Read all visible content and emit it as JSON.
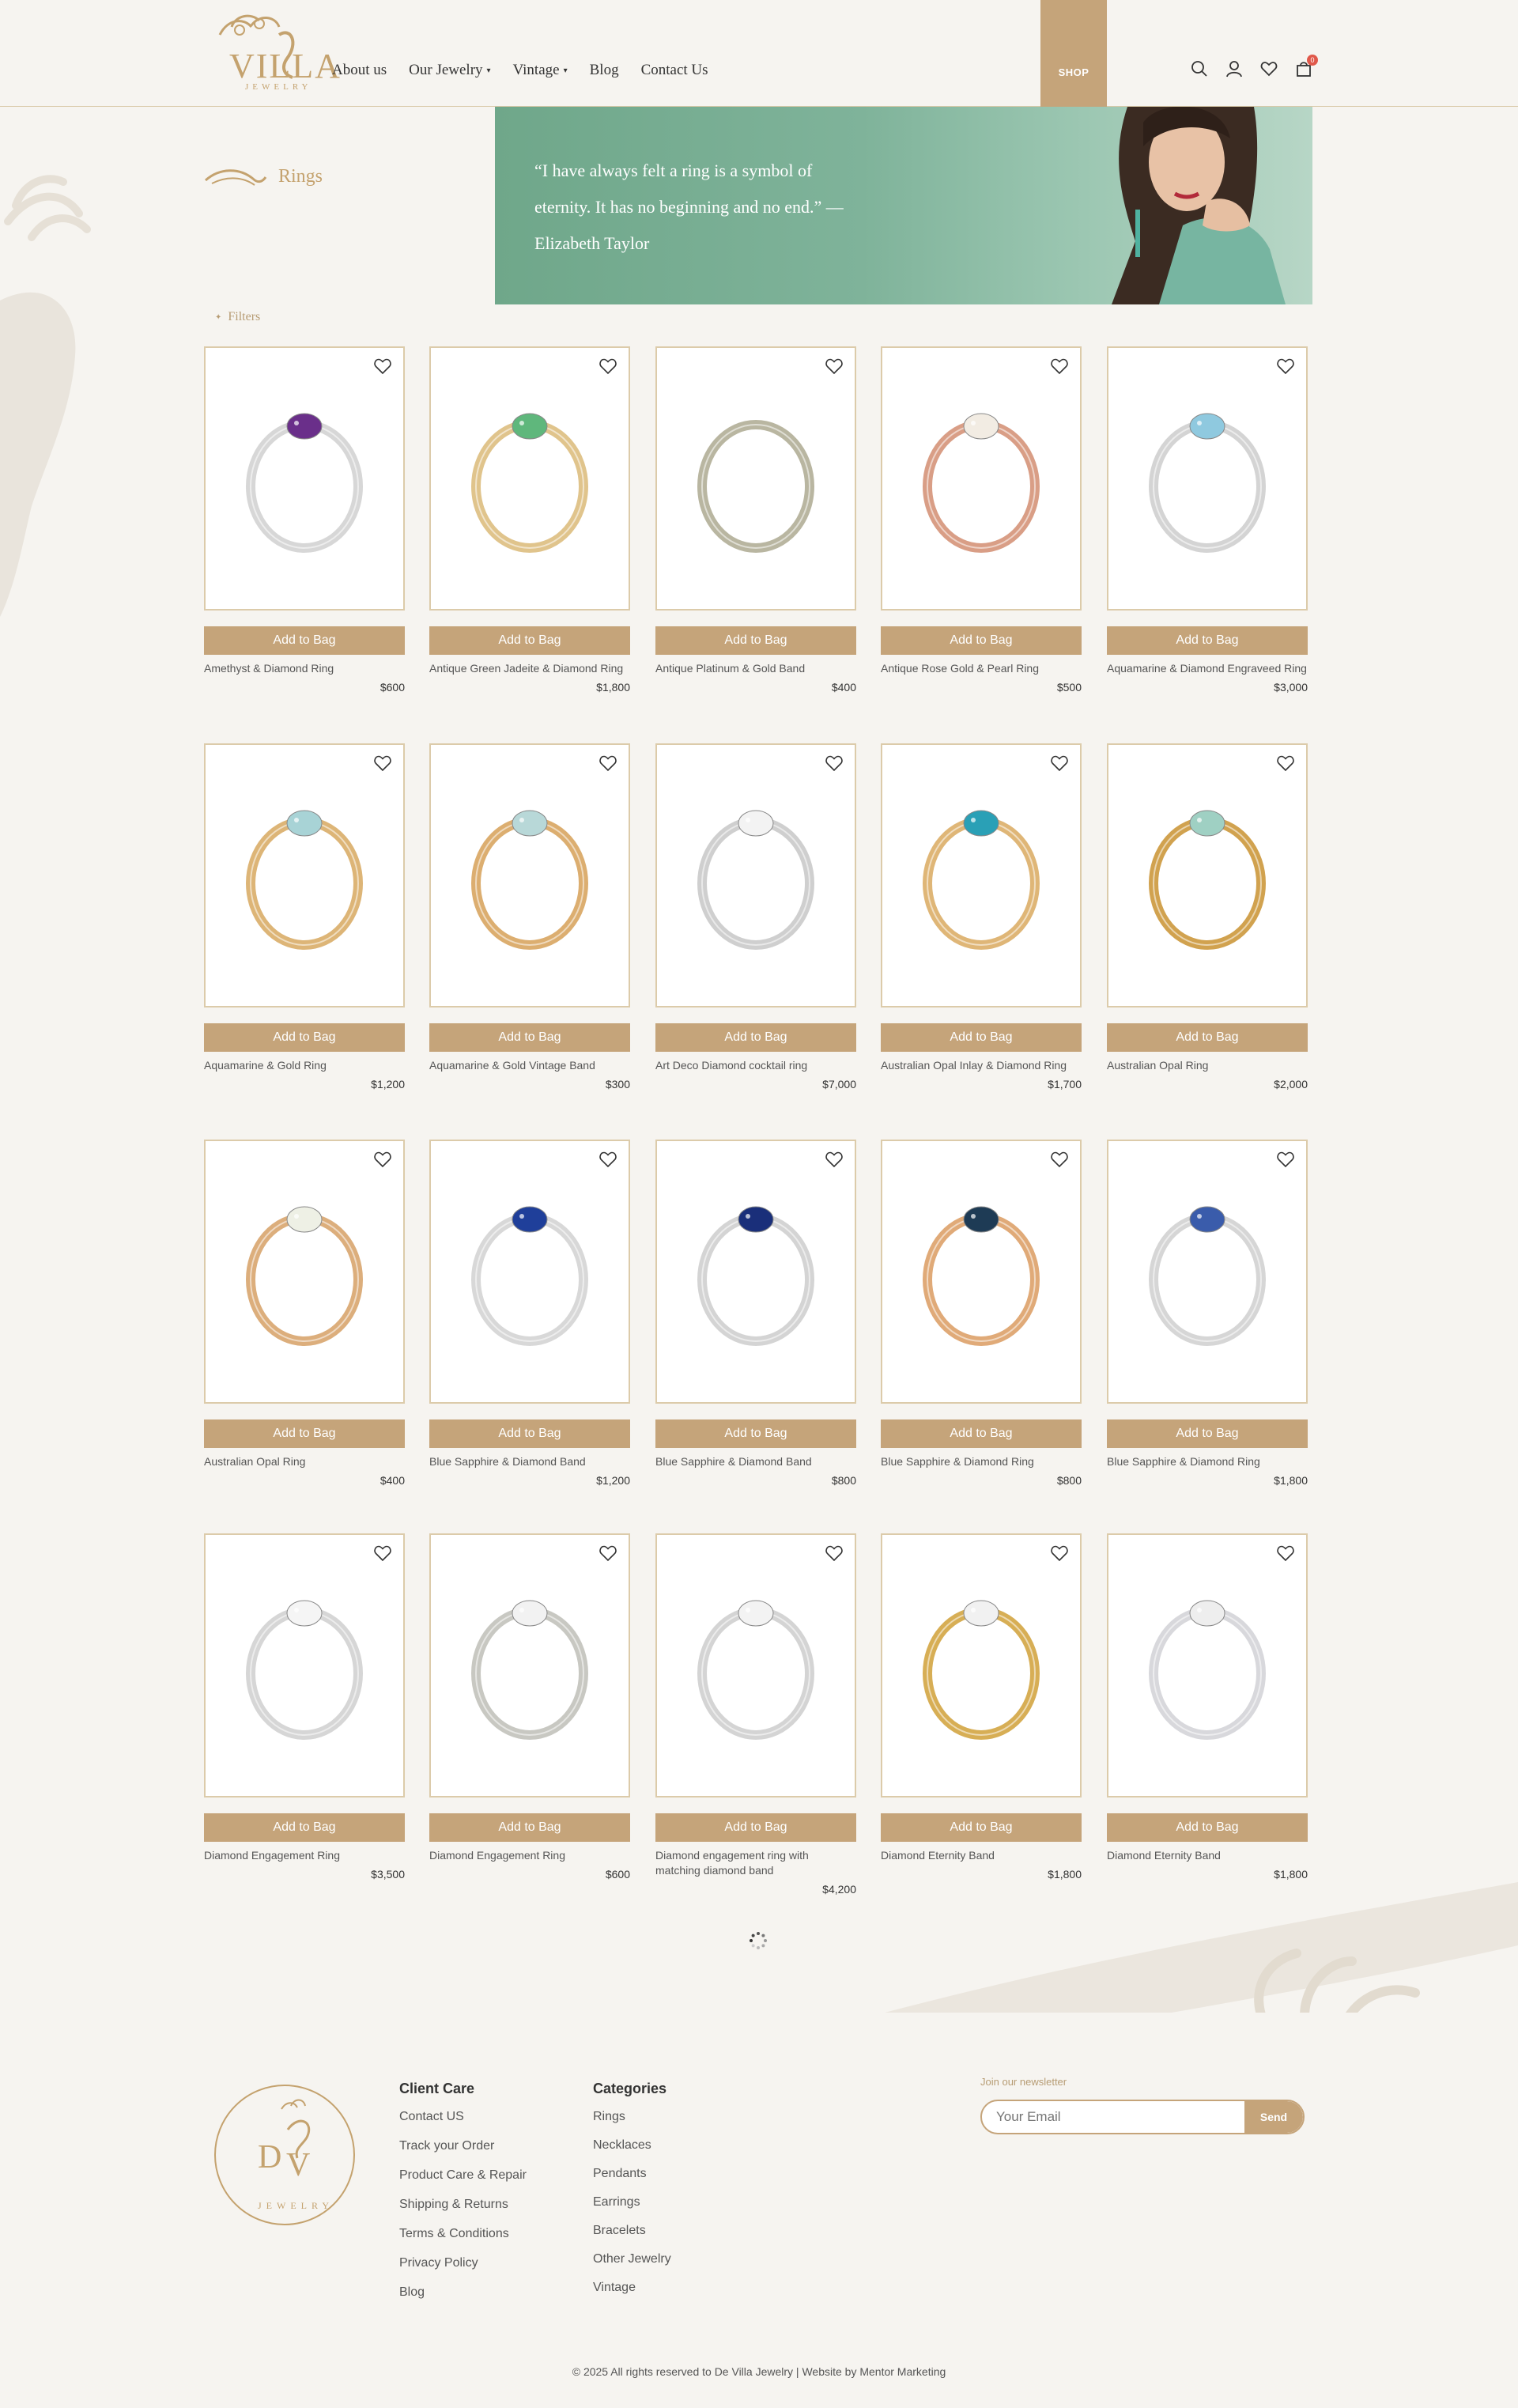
{
  "header": {
    "logo_text": "VILLA",
    "logo_sub": "JEWELRY",
    "nav": [
      {
        "label": "About us",
        "caret": false
      },
      {
        "label": "Our Jewelry",
        "caret": true
      },
      {
        "label": "Vintage",
        "caret": true
      },
      {
        "label": "Blog",
        "caret": false
      },
      {
        "label": "Contact Us",
        "caret": false
      }
    ],
    "shop_label": "SHOP",
    "cart_count": "0",
    "icons": [
      "search-icon",
      "user-icon",
      "heart-icon",
      "bag-icon"
    ]
  },
  "hero": {
    "title": "Rings",
    "quote": "“I have always felt a ring is a symbol of eternity. It has no beginning and no end.” — Elizabeth Taylor"
  },
  "filters_label": "Filters",
  "products": [
    {
      "name": "Amethyst & Diamond Ring",
      "price": "$600",
      "button": "Add to Bag",
      "metal": "#d7d7d7",
      "stone": "#6a2f8a"
    },
    {
      "name": "Antique Green Jadeite & Diamond Ring",
      "price": "$1,800",
      "button": "Add to Bag",
      "metal": "#e0c48c",
      "stone": "#5fb77c"
    },
    {
      "name": "Antique Platinum & Gold Band",
      "price": "$400",
      "button": "Add to Bag",
      "metal": "#b9b6a1",
      "stone": ""
    },
    {
      "name": "Antique Rose Gold & Pearl Ring",
      "price": "$500",
      "button": "Add to Bag",
      "metal": "#d99e86",
      "stone": "#f2ece3"
    },
    {
      "name": "Aquamarine & Diamond Engraveed Ring",
      "price": "$3,000",
      "button": "Add to Bag",
      "metal": "#d4d4d4",
      "stone": "#8fc9df"
    },
    {
      "name": "Aquamarine & Gold Ring",
      "price": "$1,200",
      "button": "Add to Bag",
      "metal": "#ddb577",
      "stone": "#a8d3d6"
    },
    {
      "name": "Aquamarine & Gold Vintage Band",
      "price": "$300",
      "button": "Add to Bag",
      "metal": "#dcae70",
      "stone": "#b8d8d8"
    },
    {
      "name": "Art Deco Diamond cocktail ring",
      "price": "$7,000",
      "button": "Add to Bag",
      "metal": "#cfcfcf",
      "stone": "#f3f3f3"
    },
    {
      "name": "Australian Opal Inlay & Diamond Ring",
      "price": "$1,700",
      "button": "Add to Bag",
      "metal": "#dfb677",
      "stone": "#2aa0b6"
    },
    {
      "name": "Australian Opal Ring",
      "price": "$2,000",
      "button": "Add to Bag",
      "metal": "#d1a24f",
      "stone": "#9fd0c3"
    },
    {
      "name": "Australian Opal Ring",
      "price": "$400",
      "button": "Add to Bag",
      "metal": "#dcae7c",
      "stone": "#eef0e5"
    },
    {
      "name": "Blue Sapphire & Diamond Band",
      "price": "$1,200",
      "button": "Add to Bag",
      "metal": "#d8d8d8",
      "stone": "#1f3f9a"
    },
    {
      "name": "Blue Sapphire & Diamond Band",
      "price": "$800",
      "button": "Add to Bag",
      "metal": "#d4d4d4",
      "stone": "#1a2f7a"
    },
    {
      "name": "Blue Sapphire & Diamond Ring",
      "price": "$800",
      "button": "Add to Bag",
      "metal": "#e0aa78",
      "stone": "#1e3b55"
    },
    {
      "name": "Blue Sapphire & Diamond Ring",
      "price": "$1,800",
      "button": "Add to Bag",
      "metal": "#d6d6d6",
      "stone": "#3a5cab"
    },
    {
      "name": "Diamond Engagement Ring",
      "price": "$3,500",
      "button": "Add to Bag",
      "metal": "#d6d6d6",
      "stone": "#f5f5f5"
    },
    {
      "name": "Diamond Engagement Ring",
      "price": "$600",
      "button": "Add to Bag",
      "metal": "#c8c8c2",
      "stone": "#f2f2f2"
    },
    {
      "name": "Diamond engagement ring with matching diamond band",
      "price": "$4,200",
      "button": "Add to Bag",
      "metal": "#d4d4d4",
      "stone": "#f3f3f3"
    },
    {
      "name": "Diamond Eternity Band",
      "price": "$1,800",
      "button": "Add to Bag",
      "metal": "#d7ae55",
      "stone": "#f1f1f1"
    },
    {
      "name": "Diamond Eternity Band",
      "price": "$1,800",
      "button": "Add to Bag",
      "metal": "#d8d8dc",
      "stone": "#eeeeee"
    }
  ],
  "footer": {
    "client_care_title": "Client Care",
    "client_care": [
      "Contact US",
      "Track your Order",
      "Product Care & Repair",
      "Shipping & Returns",
      "Terms & Conditions",
      "Privacy Policy",
      "Blog"
    ],
    "categories_title": "Categories",
    "categories": [
      "Rings",
      "Necklaces",
      "Pendants",
      "Earrings",
      "Bracelets",
      "Other Jewelry",
      "Vintage"
    ],
    "newsletter_label": "Join our newsletter",
    "email_placeholder": "Your Email",
    "send_label": "Send",
    "copyright": "© 2025 All rights reserved to De Villa Jewelry | Website by Mentor Marketing"
  },
  "colors": {
    "accent": "#c5a47a",
    "banner": "#7fb39a",
    "background": "#f6f4f0"
  }
}
